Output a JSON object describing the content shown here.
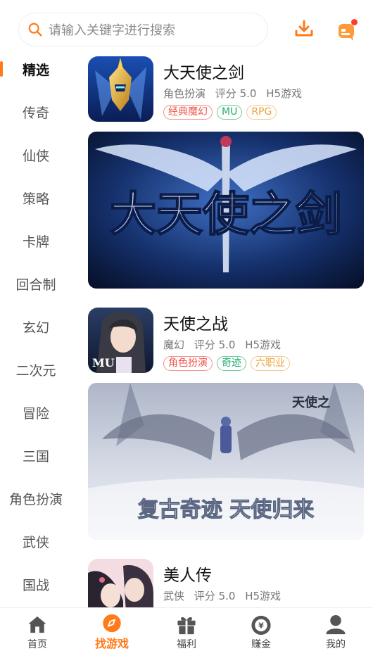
{
  "search": {
    "placeholder": "请输入关键字进行搜索"
  },
  "header": {
    "download_icon": "download-icon",
    "message_icon": "message-icon",
    "has_unread": true
  },
  "sidebar": {
    "items": [
      {
        "label": "精选",
        "active": true
      },
      {
        "label": "传奇"
      },
      {
        "label": "仙侠"
      },
      {
        "label": "策略"
      },
      {
        "label": "卡牌"
      },
      {
        "label": "回合制"
      },
      {
        "label": "玄幻"
      },
      {
        "label": "二次元"
      },
      {
        "label": "冒险"
      },
      {
        "label": "三国"
      },
      {
        "label": "角色扮演"
      },
      {
        "label": "武侠"
      },
      {
        "label": "国战"
      }
    ]
  },
  "games": [
    {
      "title": "大天使之剑",
      "category": "角色扮演",
      "rating": "评分 5.0",
      "platform": "H5游戏",
      "tags": [
        "经典魔幻",
        "MU",
        "RPG"
      ],
      "banner_text": "大天使之剑"
    },
    {
      "title": "天使之战",
      "category": "魔幻",
      "rating": "评分 5.0",
      "platform": "H5游戏",
      "tags": [
        "角色扮演",
        "奇迹",
        "六职业"
      ],
      "icon_text": "MU",
      "banner_text": "复古奇迹  天使归来",
      "banner_corner": "天使之"
    },
    {
      "title": "美人传",
      "category": "武侠",
      "rating": "评分 5.0",
      "platform": "H5游戏"
    }
  ],
  "tabbar": {
    "items": [
      {
        "label": "首页",
        "icon": "home-icon"
      },
      {
        "label": "找游戏",
        "icon": "compass-icon",
        "active": true
      },
      {
        "label": "福利",
        "icon": "gift-icon"
      },
      {
        "label": "赚金",
        "icon": "money-bag-icon"
      },
      {
        "label": "我的",
        "icon": "user-icon"
      }
    ]
  },
  "colors": {
    "accent": "#ff7a1a",
    "tag_red": "#f0544a",
    "tag_green": "#1fae6d",
    "tag_gold": "#e8a23a"
  }
}
